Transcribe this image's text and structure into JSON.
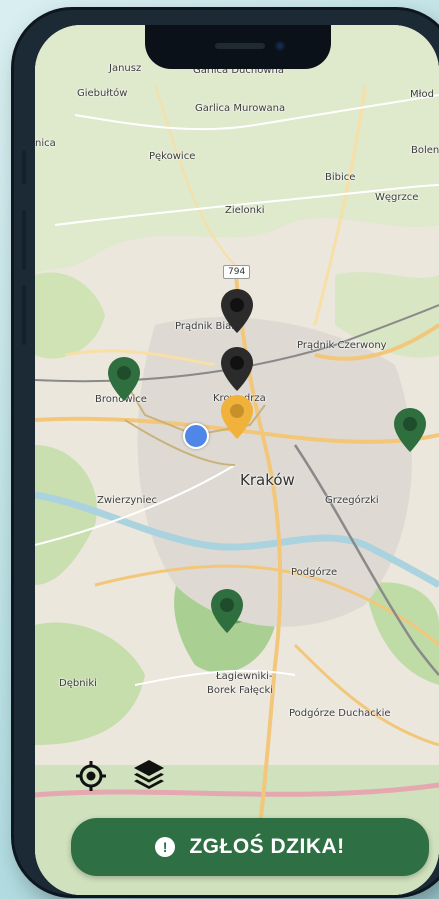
{
  "map": {
    "place_labels": [
      {
        "text": "Janusz",
        "cls": ""
      },
      {
        "text": "Garlica Duchowna",
        "cls": ""
      },
      {
        "text": "Giebułtów",
        "cls": ""
      },
      {
        "text": "Garlica Murowana",
        "cls": ""
      },
      {
        "text": "Młod",
        "cls": ""
      },
      {
        "text": "Bolen",
        "cls": ""
      },
      {
        "text": "nica",
        "cls": ""
      },
      {
        "text": "Pękowice",
        "cls": ""
      },
      {
        "text": "Bibice",
        "cls": ""
      },
      {
        "text": "Węgrzce",
        "cls": ""
      },
      {
        "text": "Zielonki",
        "cls": ""
      },
      {
        "text": "Prądnik Biały",
        "cls": ""
      },
      {
        "text": "Prądnik Czerwony",
        "cls": ""
      },
      {
        "text": "Bronowice",
        "cls": ""
      },
      {
        "text": "Krowodrza",
        "cls": ""
      },
      {
        "text": "Kraków",
        "cls": "big"
      },
      {
        "text": "Zwierzyniec",
        "cls": ""
      },
      {
        "text": "Grzegórzki",
        "cls": ""
      },
      {
        "text": "Podgórze",
        "cls": ""
      },
      {
        "text": "Dębniki",
        "cls": ""
      },
      {
        "text": "Łagiewniki-",
        "cls": ""
      },
      {
        "text": "Borek Fałęcki",
        "cls": ""
      },
      {
        "text": "Podgórze Duchackie",
        "cls": ""
      }
    ],
    "road_badges": [
      "794"
    ],
    "pins": [
      {
        "kind": "dark",
        "color": "#2b2b2b"
      },
      {
        "kind": "dark",
        "color": "#2b2b2b"
      },
      {
        "kind": "selected",
        "color": "#f0b23a"
      },
      {
        "kind": "green",
        "color": "#2f6e3e"
      },
      {
        "kind": "green",
        "color": "#2f6e3e"
      },
      {
        "kind": "green",
        "color": "#2f6e3e"
      }
    ],
    "colors": {
      "accent": "#2e7043",
      "user_location": "#4f87e8",
      "selected_pin": "#f0b23a"
    }
  },
  "controls": {
    "locate_icon": "crosshair-icon",
    "layers_icon": "layers-icon"
  },
  "report_button": {
    "icon": "exclamation-icon",
    "icon_glyph": "!",
    "label": "ZGŁOŚ DZIKA!"
  }
}
